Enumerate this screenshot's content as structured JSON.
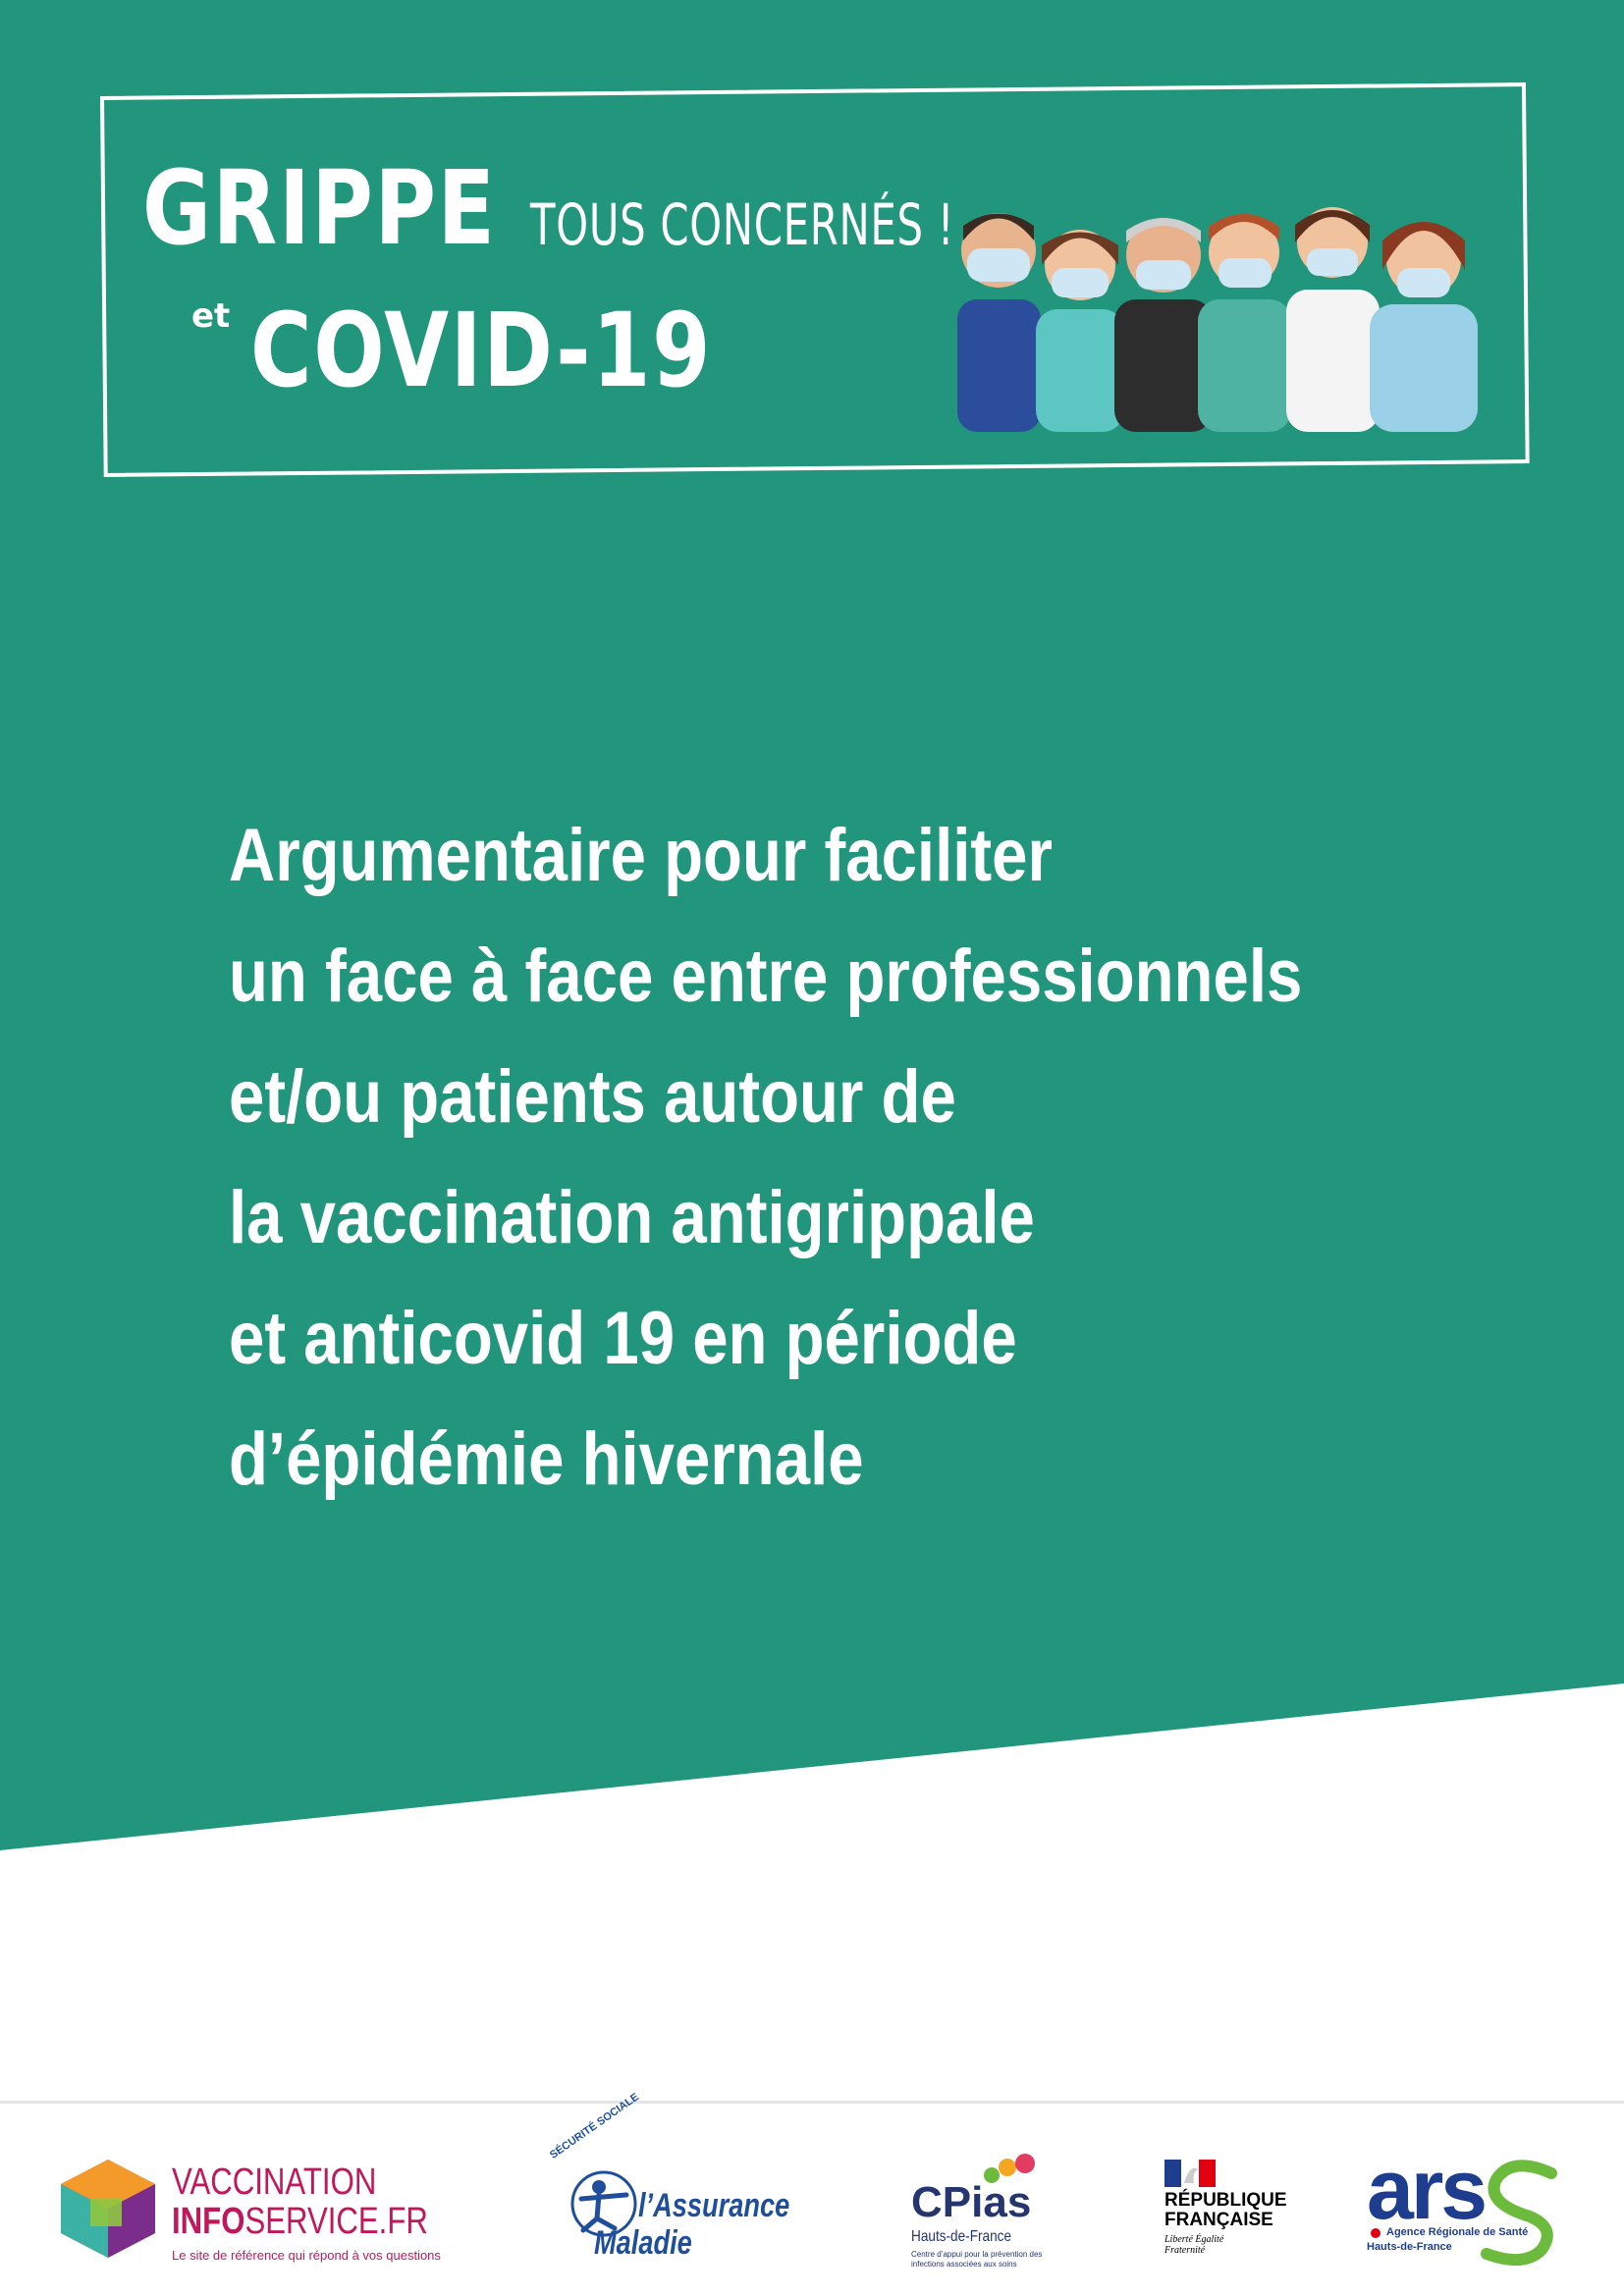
{
  "header": {
    "title_line1": "GRIPPE",
    "tagline": "TOUS CONCERNÉS !",
    "conjunction": "et",
    "title_line2": "COVID-19"
  },
  "body": {
    "lines": [
      "Argumentaire pour faciliter",
      "un face à face entre professionnels",
      "et/ou patients autour de",
      "la vaccination antigrippale",
      "et anticovid 19 en période",
      "d’épidémie hivernale"
    ]
  },
  "logos": {
    "vaccination_info_service": {
      "line1": "VACCINATION",
      "line2_bold": "INFO",
      "line2_rest": "SERVICE.FR",
      "tagline": "Le site de référence qui répond à vos questions"
    },
    "assurance_maladie": {
      "arc": "SÉCURITÉ SOCIALE",
      "line1": "l’Assurance",
      "line2": "Maladie"
    },
    "cpias": {
      "name": "CPias",
      "region": "Hauts-de-France",
      "description": "Centre d’appui pour la prévention des infections associées aux soins"
    },
    "republique": {
      "name": "RÉPUBLIQUE FRANÇAISE",
      "motto": "Liberté Égalité Fraternité"
    },
    "ars": {
      "name": "ars",
      "description": "Agence Régionale de Santé",
      "region": "Hauts-de-France"
    }
  },
  "colors": {
    "primary_green": "#22967c",
    "white": "#ffffff",
    "vis_magenta": "#c2185b",
    "am_blue": "#1f4f9c",
    "ars_green": "#6cbb3c"
  }
}
